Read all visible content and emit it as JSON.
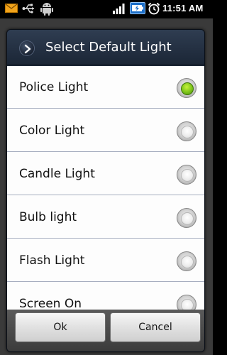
{
  "status_bar": {
    "time": "11:51 AM",
    "icons": [
      "mail-icon",
      "usb-icon",
      "android-icon",
      "signal-icon",
      "battery-icon",
      "alarm-icon"
    ]
  },
  "dialog": {
    "title": "Select Default Light",
    "header_icon": "chevron-right-icon",
    "options": [
      {
        "label": "Police Light",
        "selected": true
      },
      {
        "label": "Color Light",
        "selected": false
      },
      {
        "label": "Candle Light",
        "selected": false
      },
      {
        "label": "Bulb light",
        "selected": false
      },
      {
        "label": "Flash Light",
        "selected": false
      },
      {
        "label": "Screen On",
        "selected": false
      }
    ],
    "ok_label": "Ok",
    "cancel_label": "Cancel"
  },
  "colors": {
    "header_bg": "#1b2636",
    "list_bg": "#fdfdfd",
    "selected_radio": "#7cc41a",
    "divider": "#a7aec0"
  }
}
